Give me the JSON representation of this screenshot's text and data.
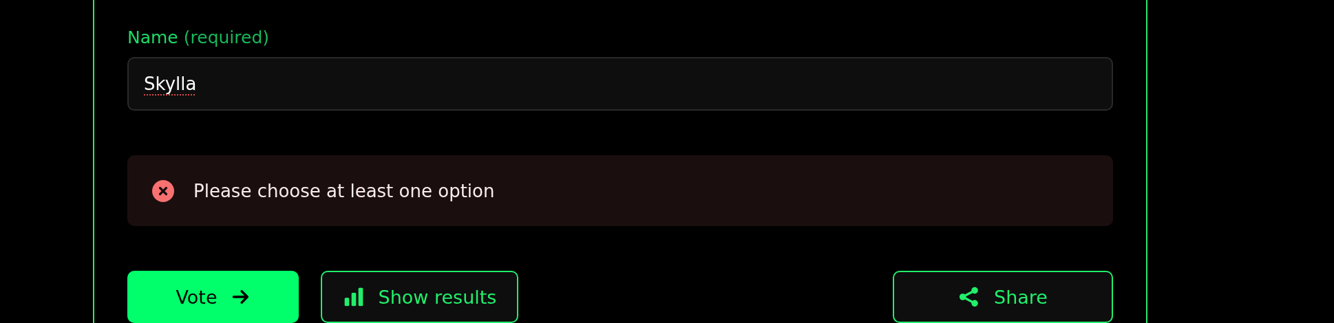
{
  "name_field": {
    "label": "Name",
    "hint": "(required)",
    "value": "Skylla",
    "spelling_error": true
  },
  "alert": {
    "kind": "error",
    "message": "Please choose at least one option"
  },
  "buttons": [
    {
      "label": "Vote",
      "kind": "vote"
    },
    {
      "label": "Show results",
      "kind": "results"
    },
    {
      "label": "Share",
      "kind": "share"
    }
  ]
}
